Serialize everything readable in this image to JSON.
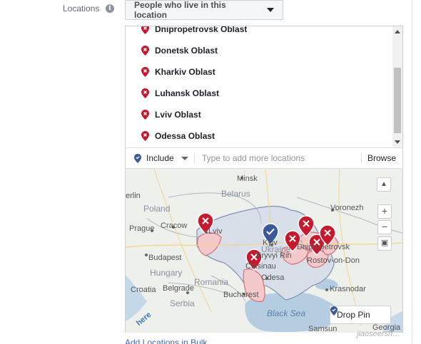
{
  "locations": {
    "label": "Locations",
    "info_icon": "i",
    "type_dropdown": "People who live in this location"
  },
  "list": {
    "items": [
      "Dnipropetrovsk Oblast",
      "Donetsk Oblast",
      "Kharkiv Oblast",
      "Luhansk Oblast",
      "Lviv Oblast",
      "Odessa Oblast"
    ],
    "pin_icon": "location-x-pin-icon"
  },
  "include_bar": {
    "include_label": "Include",
    "input_placeholder": "Type to add more locations",
    "browse_label": "Browse"
  },
  "map": {
    "labels": {
      "minsk": "Minsk",
      "belarus": "Belarus",
      "berlin": "erlin",
      "poland": "Poland",
      "prague": "Prague",
      "cracow": "Cracow",
      "lviv": "Lviv",
      "kyiv": "Kyiv",
      "voronezh": "Voronezh",
      "ukraine": "Ukraine",
      "budapest": "Budapest",
      "hungary": "Hungary",
      "kryvyi_rih": "Kryvyi Rih",
      "dnipropetrovsk": "Dnipropetrovsk",
      "rostov": "Rostov-on-Don",
      "chisinau": "Chisinau",
      "romania": "Romania",
      "odesa": "Odesa",
      "croatia": "Croatia",
      "belgrade": "Belgrade",
      "serbia": "Serbia",
      "bucharest": "Bucharest",
      "krasnodar": "Krasnodar",
      "black_sea": "Black Sea",
      "georgia": "Georgia",
      "samsun": "Samsun",
      "here": "here"
    },
    "zoom_in": "+",
    "zoom_out": "−",
    "drop_pin_label": "Drop Pin",
    "colors": {
      "land": "#eef0ec",
      "water": "#b5cde0",
      "ukraine_fill": "#d9dfe9",
      "selected_fill": "#f3c9cc",
      "selected_stroke": "#d6707a",
      "pin_red": "#c5192d",
      "pin_blue": "#3b5998"
    }
  },
  "add_bulk": "Add Locations in Bulk",
  "watermark": "jiaoseersh…"
}
